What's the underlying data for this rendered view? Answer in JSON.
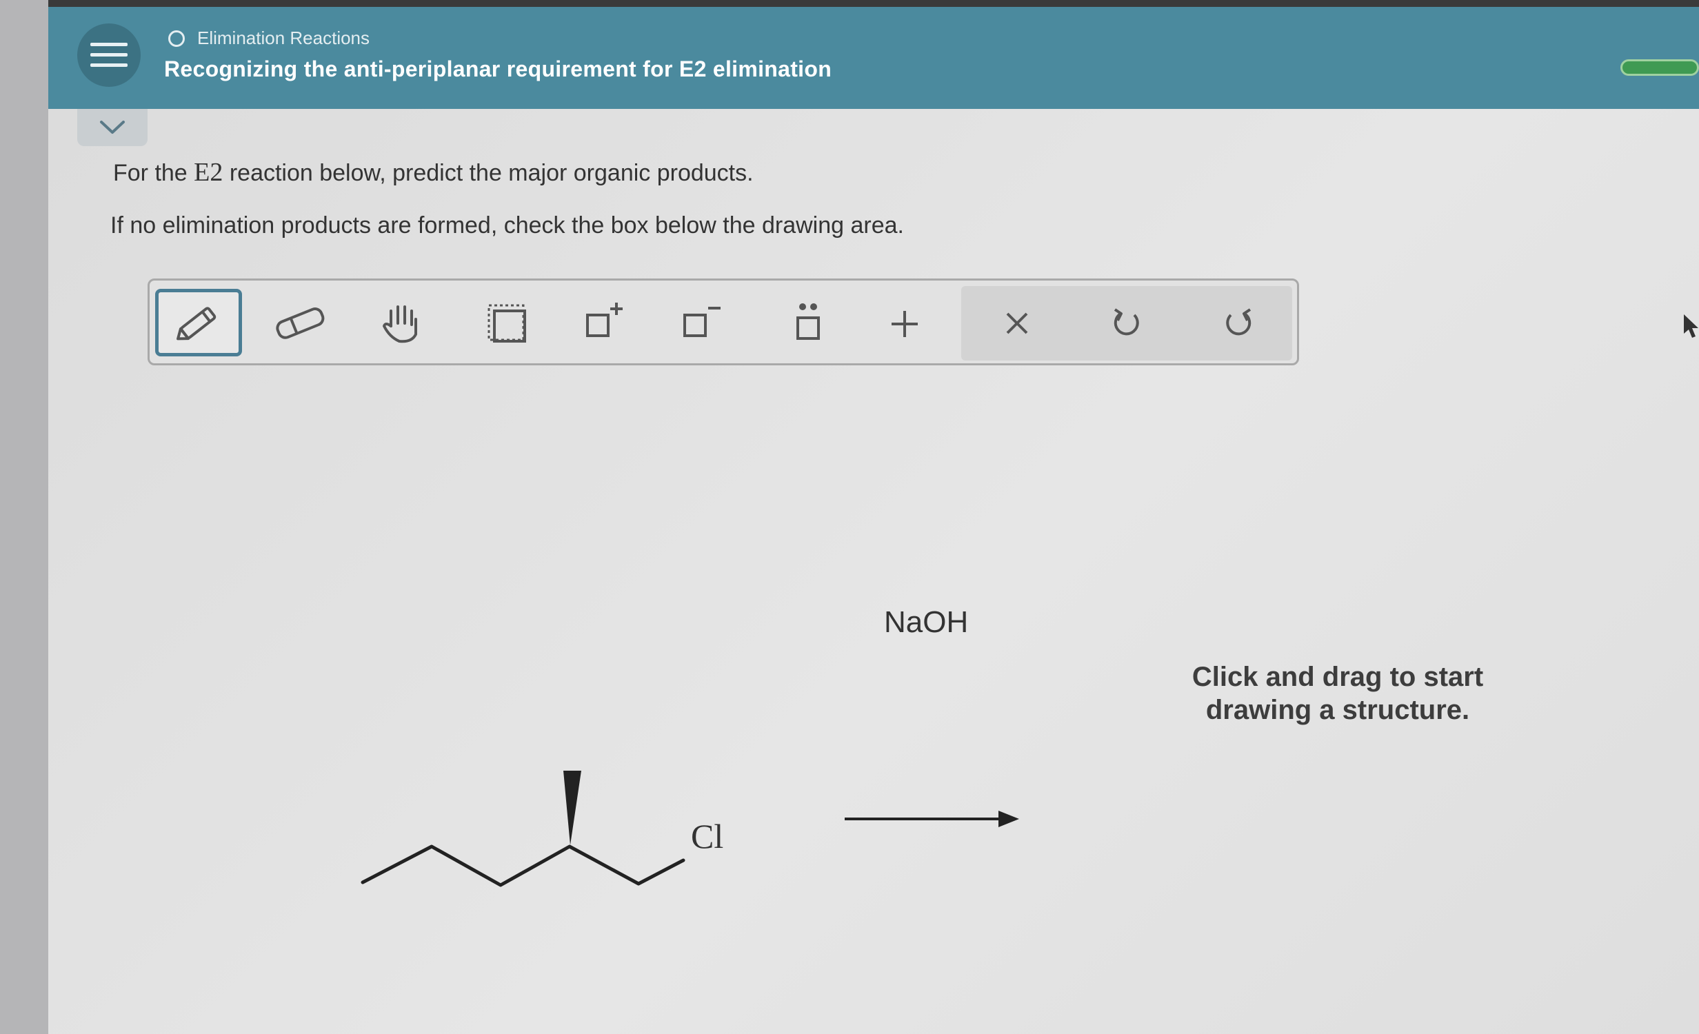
{
  "header": {
    "breadcrumb": "Elimination Reactions",
    "title": "Recognizing the anti-periplanar requirement for E2 elimination"
  },
  "question": {
    "line1_prefix": "For the ",
    "line1_e2": "E2",
    "line1_suffix": " reaction below, predict the major organic products.",
    "line2": "If no elimination products are formed, check the box below the drawing area."
  },
  "toolbar": {
    "tools": [
      "pencil-icon",
      "eraser-icon",
      "hand-icon",
      "select-icon",
      "charge-plus-icon",
      "charge-minus-icon",
      "lone-pair-icon",
      "add-reaction-icon"
    ],
    "actions": [
      "clear-icon",
      "undo-icon",
      "redo-icon"
    ]
  },
  "reaction": {
    "reagent": "NaOH",
    "leaving_group": "Cl"
  },
  "canvas": {
    "hint": "Click and drag to start drawing a structure."
  },
  "colors": {
    "header": "#4b8a9e",
    "active_tool_border": "#4a7d94",
    "progress": "#3f9a53"
  }
}
